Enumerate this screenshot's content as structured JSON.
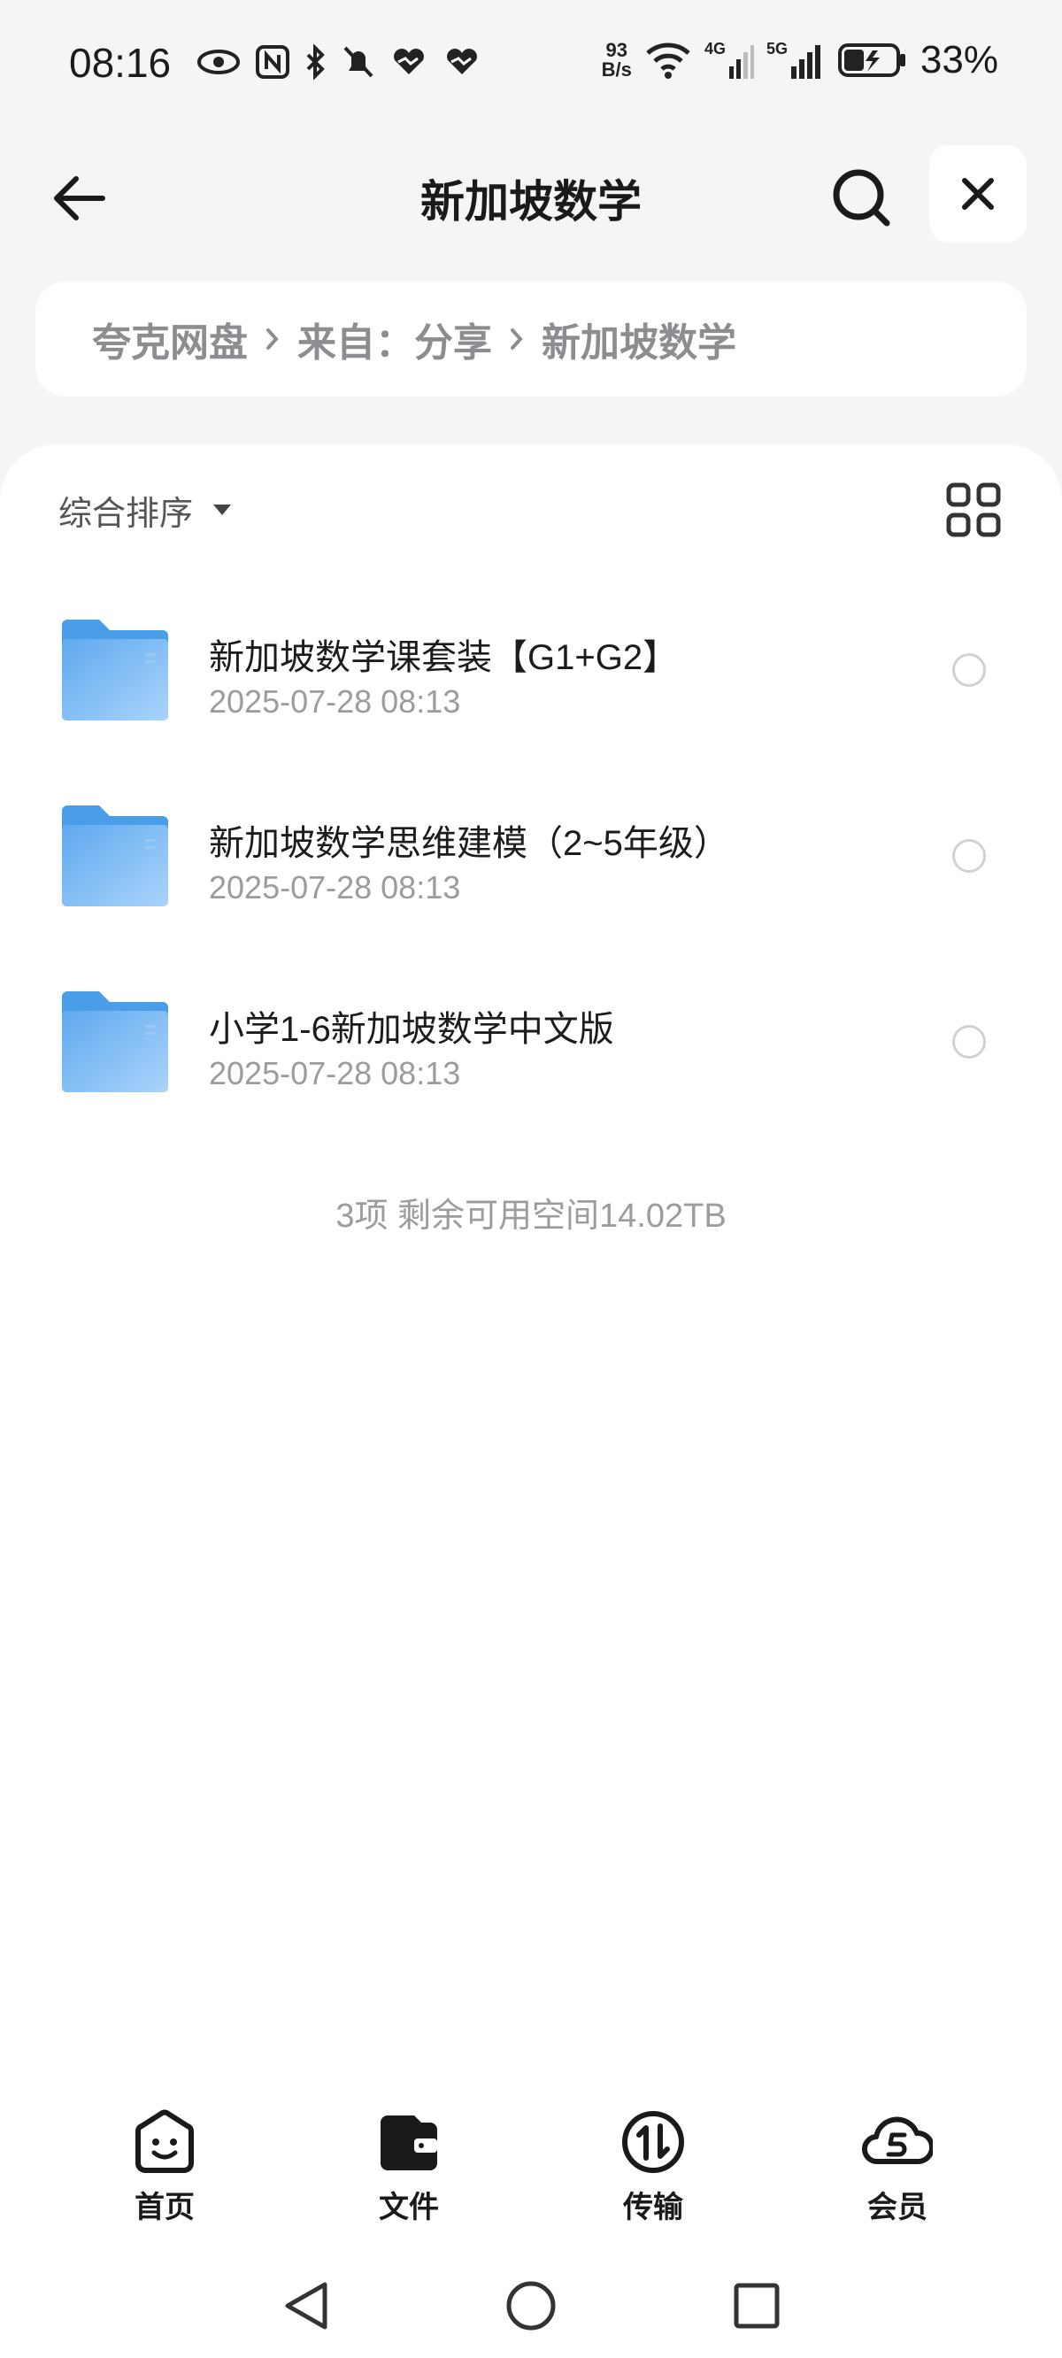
{
  "status_bar": {
    "time": "08:16",
    "net_speed_value": "93",
    "net_speed_unit": "B/s",
    "battery_percent": "33%"
  },
  "header": {
    "title": "新加坡数学"
  },
  "breadcrumb": {
    "items": [
      "夸克网盘",
      "来自：分享",
      "新加坡数学"
    ]
  },
  "toolbar": {
    "sort_label": "综合排序"
  },
  "files": [
    {
      "name": "新加坡数学课套装【G1+G2】",
      "date": "2025-07-28 08:13"
    },
    {
      "name": "新加坡数学思维建模（2~5年级）",
      "date": "2025-07-28 08:13"
    },
    {
      "name": "小学1-6新加坡数学中文版",
      "date": "2025-07-28 08:13"
    }
  ],
  "summary": "3项 剩余可用空间14.02TB",
  "bottom_nav": {
    "items": [
      {
        "label": "首页",
        "icon": "smile-face-icon"
      },
      {
        "label": "文件",
        "icon": "wallet-folder-icon"
      },
      {
        "label": "传输",
        "icon": "transfer-icon"
      },
      {
        "label": "会员",
        "icon": "cloud-s-icon"
      }
    ]
  },
  "colors": {
    "background": "#f4f5f7",
    "card": "#ffffff",
    "folder_blue": "#5aa8f0",
    "muted_text": "#9a9ca0"
  }
}
